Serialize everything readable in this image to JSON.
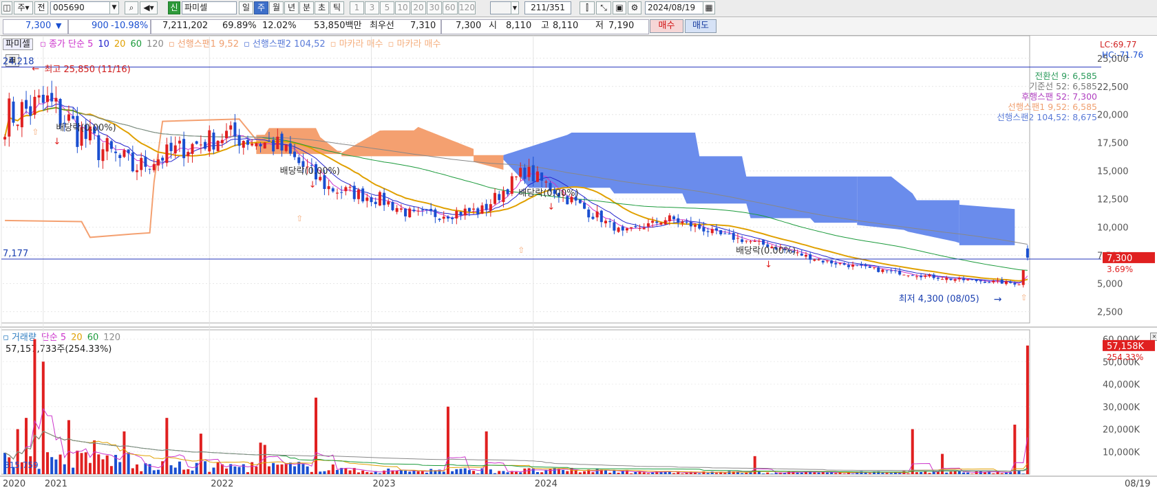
{
  "toolbar": {
    "stock_code": "005690",
    "stock_name": "파미셀",
    "new_badge": "신",
    "period_label_1": "주",
    "prev_label": "전",
    "period_tabs": [
      "일",
      "주",
      "월",
      "년",
      "분",
      "초",
      "틱"
    ],
    "active_period": "주",
    "minute_buttons": [
      "1",
      "3",
      "5",
      "10",
      "20",
      "30",
      "60",
      "120"
    ],
    "page_count": "211",
    "page_total": "/351",
    "date": "2024/08/19"
  },
  "quote": {
    "price": "7,300",
    "change": "900",
    "change_pct": "-10.98%",
    "volume": "7,211,202",
    "pct_a": "69.89%",
    "pct_b": "12.02%",
    "amount": "53,850백만",
    "best_label": "최우선",
    "best_ask": "7,310",
    "best_bid": "7,300",
    "open_label": "시",
    "open": "8,110",
    "high_label": "고",
    "high": "8,110",
    "low_label": "저",
    "low": "7,190",
    "buy_button": "매수",
    "sell_button": "매도"
  },
  "price_panel": {
    "stock_label": "파미셀",
    "legend": [
      {
        "text": "종가 단순 5",
        "color": "#cc33cc"
      },
      {
        "text": "10",
        "color": "#2222cc"
      },
      {
        "text": "20",
        "color": "#e0a000"
      },
      {
        "text": "60",
        "color": "#1a9a3a"
      },
      {
        "text": "120",
        "color": "#888888"
      },
      {
        "text": "선행스팬1 9,52",
        "color": "#f0a070"
      },
      {
        "text": "선행스팬2 104,52",
        "color": "#5a7bd8"
      },
      {
        "text": "마카라 매수",
        "color": "#f5b080"
      },
      {
        "text": "마카라 매수",
        "color": "#f5b080"
      }
    ],
    "lc": "LC:69.77",
    "hc": "HC:-71.76",
    "ichimoku": [
      {
        "text": "전환선 9: 6,585",
        "color": "#2a9a5a"
      },
      {
        "text": "기준선 52: 6,585",
        "color": "#777777"
      },
      {
        "text": "후행스팬 52: 7,300",
        "color": "#b040c0"
      },
      {
        "text": "선행스팬1 9,52: 6,585",
        "color": "#f0a070"
      },
      {
        "text": "선행스팬2 104,52: 8,675",
        "color": "#5a7bd8"
      }
    ],
    "high_note": "최고 25,850 (11/16)",
    "low_note": "최저 4,300 (08/05)",
    "upper_line_label": "24,218",
    "lower_line_label": "7,177",
    "upper_line_value": 24218,
    "lower_line_value": 7177,
    "current_price_tag": "7,300",
    "current_pct_tag": "3.69%",
    "dividend_labels": [
      "배당락(0.00%)",
      "배당락(0.00%)",
      "배당락(0.00%)",
      "배당락(0.00%)"
    ],
    "yaxis_ticks": [
      "25,000",
      "22,500",
      "20,000",
      "17,500",
      "15,000",
      "12,500",
      "10,000",
      "7,500",
      "5,000",
      "2,500"
    ]
  },
  "volume_panel": {
    "legend": [
      {
        "text": "거래량",
        "color": "#2a7bc0"
      },
      {
        "text": "단순 5",
        "color": "#cc33cc"
      },
      {
        "text": "20",
        "color": "#e0a000"
      },
      {
        "text": "60",
        "color": "#1a9a3a"
      },
      {
        "text": "120",
        "color": "#888888"
      }
    ],
    "info": "57,157,733주(254.33%)",
    "tag_value": "57,158K",
    "tag_pct": "254.33%",
    "yaxis_ticks": [
      "60,000K",
      "50,000K",
      "40,000K",
      "30,000K",
      "20,000K",
      "10,000K"
    ],
    "bottom_label": "815,759"
  },
  "xaxis": {
    "labels": [
      "2020",
      "2021",
      "2022",
      "2023",
      "2024"
    ],
    "right_label": "08/19"
  },
  "colors": {
    "up": "#e02020",
    "down": "#1a4fd0",
    "cloud_bull": "#f4a070",
    "cloud_bear": "#6a8cec",
    "accent": "#3d6fc9"
  },
  "chart_data": {
    "type": "candlestick",
    "weeks": 241,
    "start_week": "2020",
    "end_date": "2024/08/19",
    "close_anchors": [
      [
        0,
        19800
      ],
      [
        10,
        21000
      ],
      [
        20,
        17600
      ],
      [
        30,
        15200
      ],
      [
        40,
        16800
      ],
      [
        52,
        18200
      ],
      [
        64,
        17200
      ],
      [
        76,
        13500
      ],
      [
        88,
        12500
      ],
      [
        96,
        11000
      ],
      [
        112,
        11500
      ],
      [
        122,
        15000
      ],
      [
        132,
        12600
      ],
      [
        145,
        9500
      ],
      [
        156,
        10800
      ],
      [
        168,
        9300
      ],
      [
        180,
        8300
      ],
      [
        192,
        7000
      ],
      [
        205,
        6200
      ],
      [
        222,
        5400
      ],
      [
        238,
        5000
      ],
      [
        240,
        7300
      ]
    ],
    "volume_spikes": [
      [
        3,
        20000
      ],
      [
        5,
        25000
      ],
      [
        7,
        60000
      ],
      [
        9,
        50000
      ],
      [
        15,
        24000
      ],
      [
        21,
        15000
      ],
      [
        28,
        19000
      ],
      [
        38,
        25000
      ],
      [
        46,
        18000
      ],
      [
        60,
        14000
      ],
      [
        61,
        13000
      ],
      [
        73,
        34000
      ],
      [
        104,
        30000
      ],
      [
        113,
        19000
      ],
      [
        176,
        8000
      ],
      [
        213,
        20000
      ],
      [
        220,
        9000
      ],
      [
        237,
        22000
      ],
      [
        240,
        57158
      ]
    ],
    "series": [
      {
        "name": "종가 단순 5",
        "period": 5,
        "color": "#cc33cc"
      },
      {
        "name": "10",
        "period": 10,
        "color": "#2222cc"
      },
      {
        "name": "20",
        "period": 20,
        "color": "#e0a000"
      },
      {
        "name": "60",
        "period": 60,
        "color": "#1a9a3a"
      },
      {
        "name": "120",
        "period": 120,
        "color": "#888888"
      }
    ],
    "price_ylim": [
      1500,
      27000
    ],
    "volume_ylim": [
      0,
      62000
    ]
  }
}
